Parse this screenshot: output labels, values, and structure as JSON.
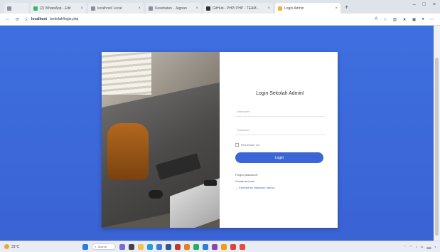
{
  "browser": {
    "tabs": [
      {
        "title": "",
        "active": false
      },
      {
        "title": "(2) WhatsApp - Edit",
        "active": false
      },
      {
        "title": "localhost/ Local",
        "active": false
      },
      {
        "title": "Kesehatan - Jagoan",
        "active": false
      },
      {
        "title": "GitHub - PHP/ PHP - TEAM...",
        "active": false
      },
      {
        "title": "Login Admin",
        "active": true
      }
    ],
    "new_tab": "+",
    "window_buttons": [
      "–",
      "□",
      "×"
    ],
    "url_host": "localhost",
    "url_path": "/sekolah/login.php"
  },
  "login": {
    "title": "Login Sekolah Admin!",
    "username_placeholder": "Username",
    "password_placeholder": "Password",
    "remember_label": "Remember me",
    "button_label": "Login",
    "forgot_password": "Forgot password?",
    "create_account": "Create account",
    "back_link": "← Kembali ke Halaman Utama"
  },
  "taskbar": {
    "weather": "31°C",
    "search": "Search"
  },
  "colors": {
    "background": "#3e6fe0",
    "button": "#3c65d6"
  }
}
